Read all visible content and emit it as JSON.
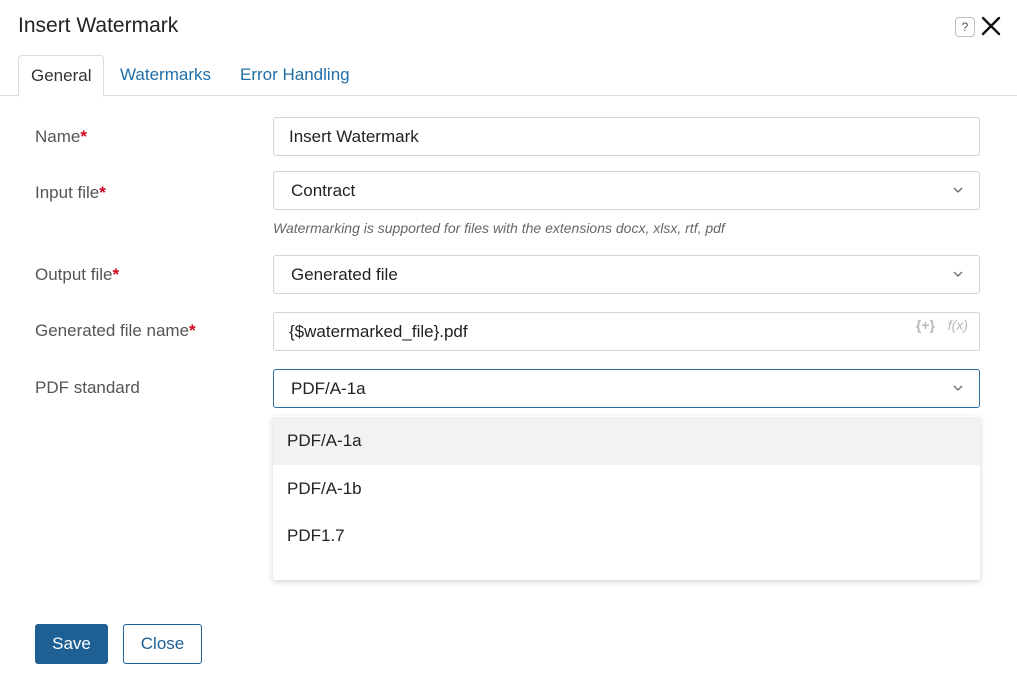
{
  "dialog": {
    "title": "Insert Watermark",
    "help_glyph": "?",
    "close_label": "Close dialog"
  },
  "tabs": [
    {
      "label": "General",
      "active": true
    },
    {
      "label": "Watermarks",
      "active": false
    },
    {
      "label": "Error Handling",
      "active": false
    }
  ],
  "form": {
    "name": {
      "label": "Name",
      "required": "*",
      "value": "Insert Watermark"
    },
    "input_file": {
      "label": "Input file",
      "required": "*",
      "value": "Contract",
      "hint": "Watermarking is supported for files with the extensions docx, xlsx, rtf, pdf"
    },
    "output_file": {
      "label": "Output file",
      "required": "*",
      "value": "Generated file"
    },
    "generated_file_name": {
      "label": "Generated file name",
      "required": "*",
      "value": "{$watermarked_file}.pdf",
      "var_glyph": "{+}",
      "fx_glyph": "f(x)"
    },
    "pdf_standard": {
      "label": "PDF standard",
      "value": "PDF/A-1a"
    }
  },
  "dropdown": {
    "options": [
      "PDF/A-1a",
      "PDF/A-1b",
      "PDF1.7"
    ],
    "highlighted": "PDF/A-1a"
  },
  "footer": {
    "save_label": "Save",
    "close_label": "Close"
  },
  "colors": {
    "accent": "#1e5f94",
    "link": "#1f6ea8",
    "required": "#d0021b"
  }
}
